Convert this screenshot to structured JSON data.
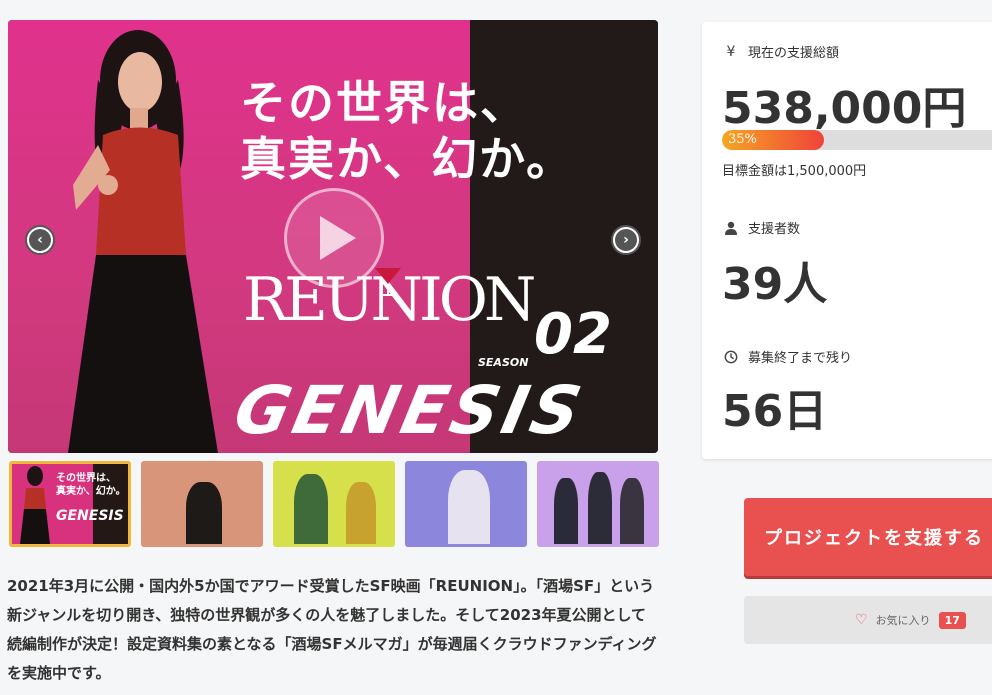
{
  "hero": {
    "headline": "その世界は、\n真実か、幻か。",
    "logo_title": "REUNION",
    "season_label": "SEASON",
    "season_number": "02",
    "subtitle_logo": "GENESIS"
  },
  "thumbnails": [
    {
      "headline": "その世界は、\n真実か、幻か。",
      "logo": "GENESIS"
    },
    {},
    {},
    {},
    {}
  ],
  "description": "2021年3月に公開・国内外5か国でアワード受賞したSF映画「REUNION」。「酒場SF」という新ジャンルを切り開き、独特の世界観が多くの人を魅了しました。そして2023年夏公開として続編制作が決定！設定資料集の素となる「酒場SFメルマガ」が毎週届くクラウドファンディングを実施中です。",
  "stats": {
    "total_label": "現在の支援総額",
    "total_value": "538,000円",
    "progress_percent": 35,
    "progress_text": "35%",
    "goal_text": "目標金額は1,500,000円",
    "supporters_label": "支援者数",
    "supporters_value": "39人",
    "remaining_label": "募集終了まで残り",
    "remaining_value": "56日",
    "icons": {
      "total": "yen-icon",
      "supporters": "person-icon",
      "remaining": "clock-icon"
    }
  },
  "actions": {
    "support_label": "プロジェクトを支援する",
    "favorite_label": "お気に入り",
    "favorite_count": "17"
  },
  "colors": {
    "accent": "#e8514f",
    "thumb_active_border": "#f0b73a",
    "hero_pink": "#e0328c",
    "hero_dark": "#221a18"
  }
}
